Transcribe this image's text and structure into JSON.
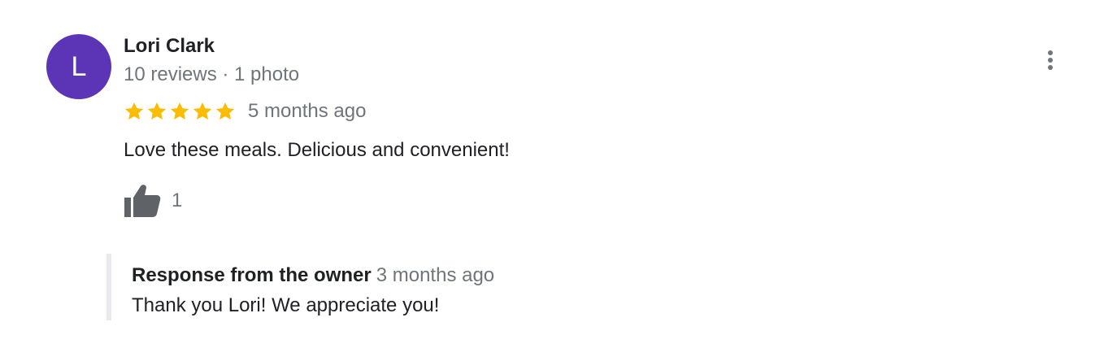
{
  "review": {
    "avatar_initial": "L",
    "avatar_color": "#5b35b5",
    "reviewer_name": "Lori Clark",
    "reviewer_meta": "10 reviews · 1 photo",
    "rating": 5,
    "max_rating": 5,
    "star_color": "#fbbc04",
    "time": "5 months ago",
    "text": "Love these meals. Delicious and convenient!",
    "like_icon": "thumbs-up-icon",
    "like_count": "1",
    "menu_icon": "more-vert-icon"
  },
  "owner_response": {
    "title": "Response from the owner",
    "time": "3 months ago",
    "text": "Thank you Lori! We appreciate you!"
  }
}
